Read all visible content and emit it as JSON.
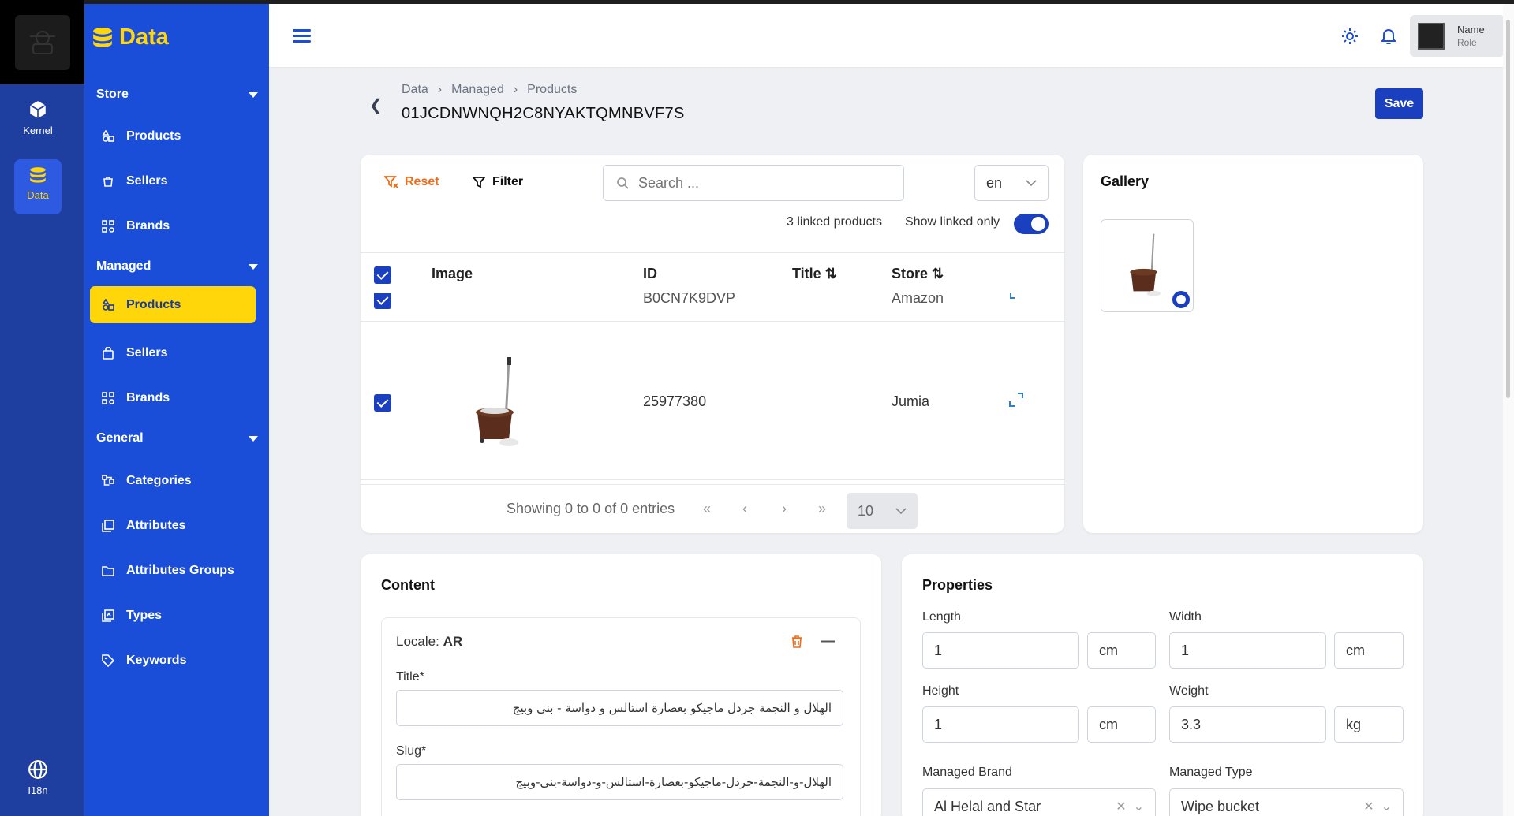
{
  "rail": {
    "kernel_label": "Kernel",
    "data_label": "Data",
    "i18n_label": "I18n"
  },
  "sidebar": {
    "brand": "Data",
    "sections": {
      "store": "Store",
      "managed": "Managed",
      "general": "General"
    },
    "store_items": [
      "Products",
      "Sellers",
      "Brands"
    ],
    "managed_items": [
      "Products",
      "Sellers",
      "Brands"
    ],
    "general_items": [
      "Categories",
      "Attributes",
      "Attributes Groups",
      "Types",
      "Keywords"
    ]
  },
  "header": {
    "user_name": "Name",
    "user_role": "Role"
  },
  "page": {
    "breadcrumb": [
      "Data",
      "Managed",
      "Products"
    ],
    "product_id": "01JCDNWNQH2C8NYAKTQMNBVF7S",
    "save_label": "Save"
  },
  "linked_panel": {
    "reset_label": "Reset",
    "filter_label": "Filter",
    "search_placeholder": "Search ...",
    "language": "en",
    "linked_count_text": "3 linked products",
    "show_linked_label": "Show linked only",
    "columns": {
      "image": "Image",
      "id": "ID",
      "title": "Title",
      "store": "Store"
    },
    "rows": [
      {
        "id": "B0CN7K9DVP",
        "store": "Amazon"
      },
      {
        "id": "25977380",
        "store": "Jumia"
      }
    ],
    "pager_text": "Showing 0 to 0 of 0 entries",
    "page_size": "10"
  },
  "gallery": {
    "title": "Gallery"
  },
  "content": {
    "title": "Content",
    "locale_label": "Locale:",
    "locale_code": "AR",
    "title_label": "Title*",
    "title_value": "الهلال و النجمة جردل ماجيكو بعصارة استالس و دواسة - بنى وبيج",
    "slug_label": "Slug*",
    "slug_value": "الهلال-و-النجمة-جردل-ماجيكو-بعصارة-استالس-و-دواسة-بنى-وبيج"
  },
  "properties": {
    "title": "Properties",
    "length_label": "Length",
    "length_value": "1",
    "length_unit": "cm",
    "width_label": "Width",
    "width_value": "1",
    "width_unit": "cm",
    "height_label": "Height",
    "height_value": "1",
    "height_unit": "cm",
    "weight_label": "Weight",
    "weight_value": "3.3",
    "weight_unit": "kg",
    "brand_label": "Managed Brand",
    "brand_value": "Al Helal and Star",
    "type_label": "Managed Type",
    "type_value": "Wipe bucket"
  },
  "colors": {
    "sidebar": "#1a4ed8",
    "rail": "#1e3fa0",
    "accent": "#ffd60a",
    "primary": "#1a3fbf",
    "reset": "#ef6c1a"
  }
}
